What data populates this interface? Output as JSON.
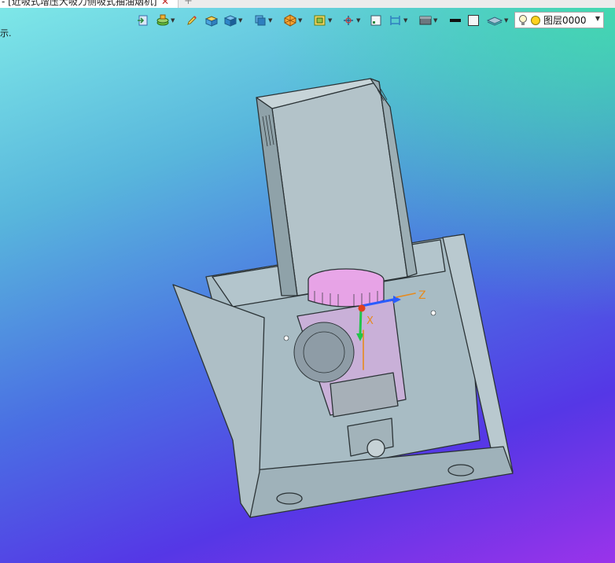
{
  "document_tab": {
    "title": "- [近吸式增压大吸力侧吸式抽油烟机]",
    "close_glyph": "✕",
    "new_tab_glyph": "+"
  },
  "status_fragment": "示.",
  "toolbar": {
    "icons": [
      "document-arrow-icon",
      "layer-stack-icon",
      "pencil-icon",
      "box-highlight-icon",
      "solid-box-icon",
      "view-cube-icon",
      "render-style-icon",
      "section-view-icon",
      "axis-pivot-icon",
      "frame-icon",
      "dimension-icon",
      "display-mode-icon",
      "line-color-icon",
      "fill-color-icon",
      "plane-layer-icon"
    ],
    "layer_combo": {
      "label": "图层0000"
    }
  },
  "viewport": {
    "triad": {
      "x_label": "X",
      "z_label": "Z"
    },
    "colors": {
      "bg_top": "#7fe9e8",
      "bg_bottom": "#9a33ea",
      "bg_corner": "#3ce6a0",
      "metal": "#a3b6be",
      "pink": "#e8a6e8",
      "triad_x": "#e2411c",
      "triad_y": "#22c44a",
      "triad_z": "#2a5cff"
    }
  }
}
